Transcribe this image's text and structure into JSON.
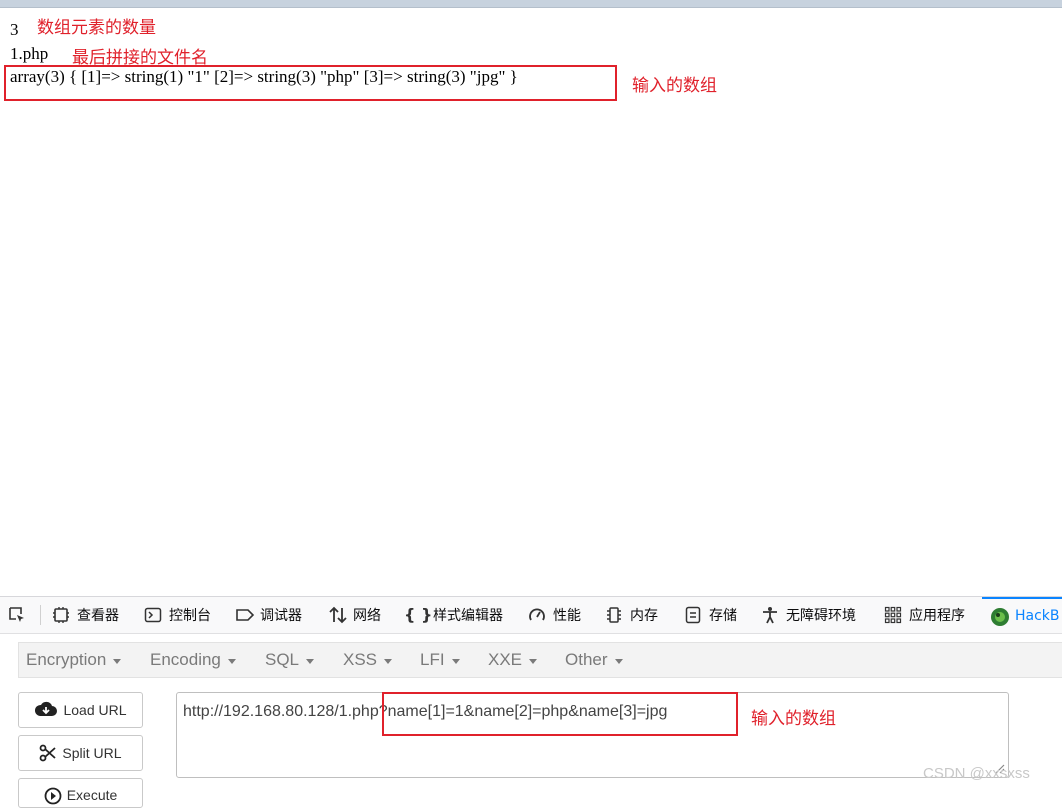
{
  "output": {
    "count_value": "3",
    "count_note": "数组元素的数量",
    "filename_value": "1.php",
    "filename_note": "最后拼接的文件名",
    "dump_line": "array(3) { [1]=> string(1) \"1\" [2]=> string(3) \"php\" [3]=> string(3) \"jpg\" }",
    "dump_note": "输入的数组"
  },
  "devtools": {
    "tabs": [
      {
        "label": "",
        "icon": "element-picker-icon"
      },
      {
        "label": "查看器",
        "icon": "inspector-icon"
      },
      {
        "label": "控制台",
        "icon": "console-icon"
      },
      {
        "label": "调试器",
        "icon": "debugger-icon"
      },
      {
        "label": "网络",
        "icon": "network-icon"
      },
      {
        "label": "样式编辑器",
        "icon": "style-editor-icon"
      },
      {
        "label": "性能",
        "icon": "performance-icon"
      },
      {
        "label": "内存",
        "icon": "memory-icon"
      },
      {
        "label": "存储",
        "icon": "storage-icon"
      },
      {
        "label": "无障碍环境",
        "icon": "accessibility-icon"
      },
      {
        "label": "应用程序",
        "icon": "application-icon"
      },
      {
        "label": "HackB",
        "icon": "hackbar-icon"
      }
    ],
    "active_tab": "HackB"
  },
  "hackbar": {
    "menus": [
      "Encryption",
      "Encoding",
      "SQL",
      "XSS",
      "LFI",
      "XXE",
      "Other"
    ],
    "buttons": {
      "load_url": "Load URL",
      "split_url": "Split URL",
      "execute": "Execute"
    },
    "url_value": "http://192.168.80.128/1.php?name[1]=1&name[2]=php&name[3]=jpg",
    "url_note": "输入的数组"
  },
  "watermark": "CSDN @xxsxss",
  "colors": {
    "annotation_red": "#e0212b",
    "active_tab_blue": "#0a84ff"
  }
}
